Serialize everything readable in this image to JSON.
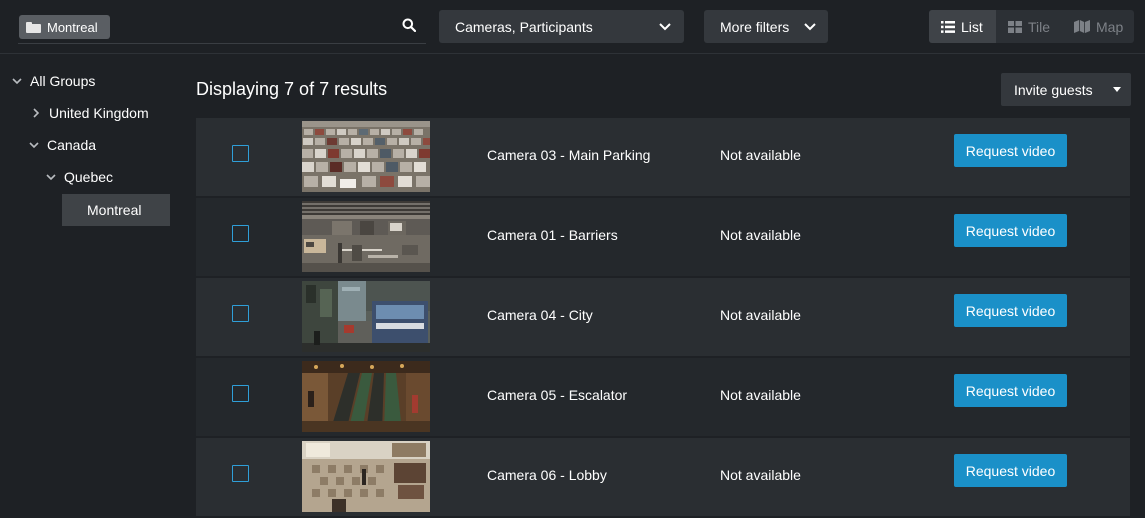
{
  "search": {
    "chip_label": "Montreal"
  },
  "filters": {
    "cameras_label": "Cameras, Participants",
    "more_label": "More filters"
  },
  "view_toggle": {
    "list_label": "List",
    "tile_label": "Tile",
    "map_label": "Map",
    "active": "List"
  },
  "tree": {
    "all_groups": "All Groups",
    "united_kingdom": "United Kingdom",
    "canada": "Canada",
    "quebec": "Quebec",
    "montreal": "Montreal"
  },
  "results": {
    "title": "Displaying 7 of 7 results",
    "invite_label": "Invite guests"
  },
  "cameras": [
    {
      "name": "Camera 03 - Main Parking",
      "status": "Not available",
      "action": "Request video",
      "thumb": "parking"
    },
    {
      "name": "Camera 01 - Barriers",
      "status": "Not available",
      "action": "Request video",
      "thumb": "barriers"
    },
    {
      "name": "Camera 04 - City",
      "status": "Not available",
      "action": "Request video",
      "thumb": "city"
    },
    {
      "name": "Camera 05 - Escalator",
      "status": "Not available",
      "action": "Request video",
      "thumb": "escalator"
    },
    {
      "name": "Camera 06 - Lobby",
      "status": "Not available",
      "action": "Request video",
      "thumb": "lobby"
    }
  ],
  "colors": {
    "background": "#1e2125",
    "accent": "#1a90c8",
    "checkbox_border": "#2f9fd8"
  }
}
